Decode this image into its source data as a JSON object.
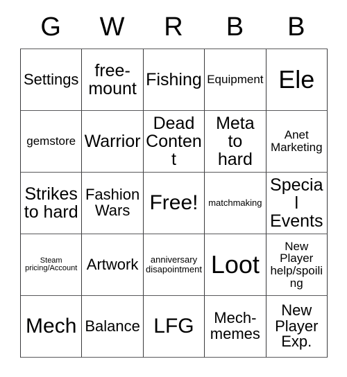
{
  "card": {
    "headers": [
      "G",
      "W",
      "R",
      "B",
      "B"
    ],
    "rows": [
      [
        {
          "text": "Settings",
          "size": "m"
        },
        {
          "text": "free-\nmount",
          "size": "l"
        },
        {
          "text": "Fishing",
          "size": "l"
        },
        {
          "text": "Equipment",
          "size": "s"
        },
        {
          "text": "Ele",
          "size": "xxl"
        }
      ],
      [
        {
          "text": "gemstore",
          "size": "s"
        },
        {
          "text": "Warrior",
          "size": "l"
        },
        {
          "text": "Dead\nContent",
          "size": "l"
        },
        {
          "text": "Meta to\nhard",
          "size": "l"
        },
        {
          "text": "Anet\nMarketing",
          "size": "s"
        }
      ],
      [
        {
          "text": "Strikes\nto hard",
          "size": "l"
        },
        {
          "text": "Fashion\nWars",
          "size": "m"
        },
        {
          "text": "Free!",
          "size": "xl"
        },
        {
          "text": "matchmaking",
          "size": "xs"
        },
        {
          "text": "Special\nEvents",
          "size": "l"
        }
      ],
      [
        {
          "text": "Steam\npricing/Account",
          "size": "xxs"
        },
        {
          "text": "Artwork",
          "size": "m"
        },
        {
          "text": "anniversary\ndisapointment",
          "size": "xs"
        },
        {
          "text": "Loot",
          "size": "xxl"
        },
        {
          "text": "New Player\nhelp/spoiling",
          "size": "s"
        }
      ],
      [
        {
          "text": "Mech",
          "size": "xl"
        },
        {
          "text": "Balance",
          "size": "m"
        },
        {
          "text": "LFG",
          "size": "xl"
        },
        {
          "text": "Mech-\nmemes",
          "size": "m"
        },
        {
          "text": "New\nPlayer\nExp.",
          "size": "m"
        }
      ]
    ]
  }
}
